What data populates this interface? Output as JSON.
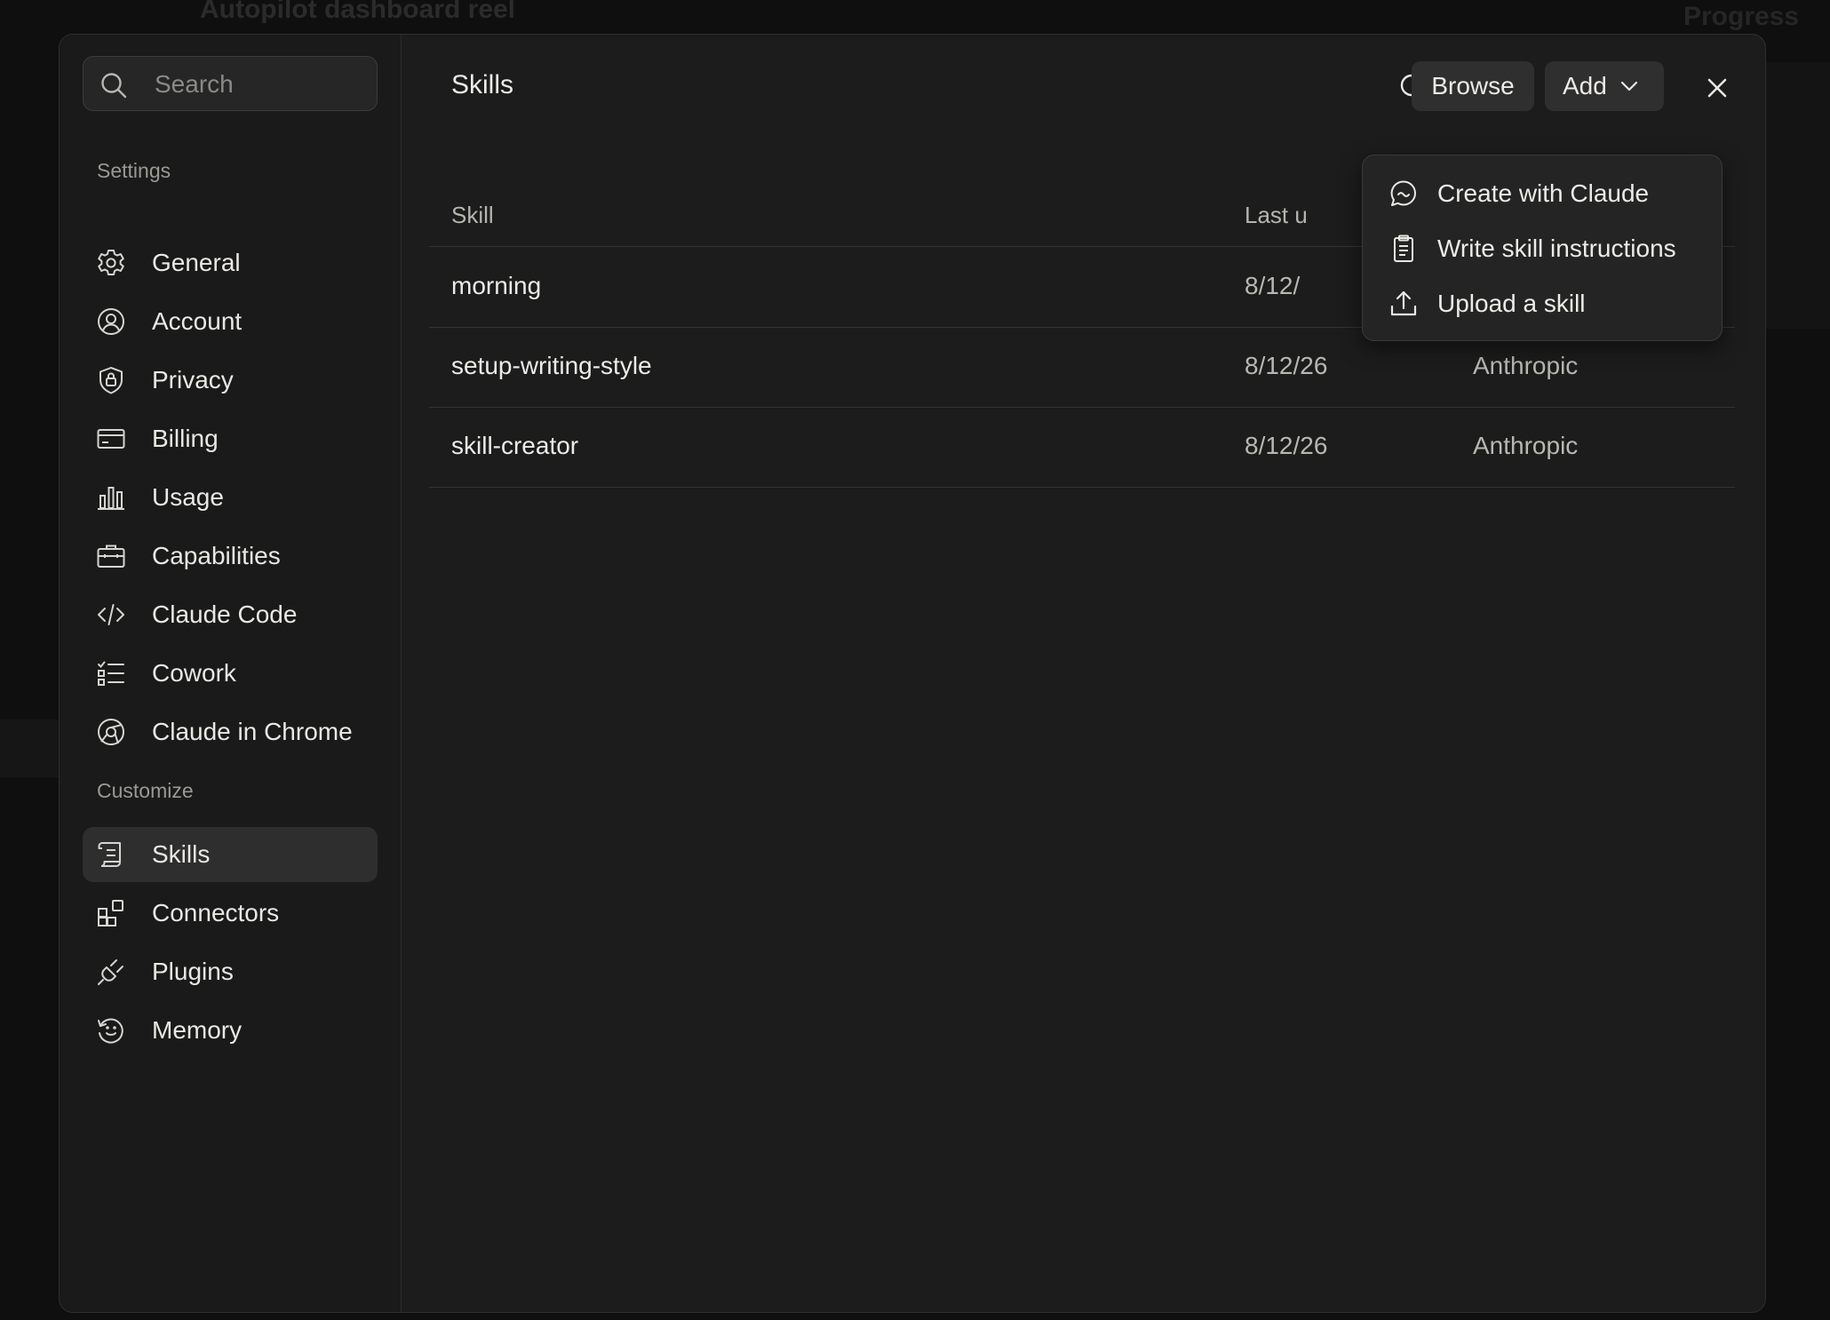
{
  "background": {
    "title": "Autopilot dashboard reel",
    "progress_label": "Progress"
  },
  "sidebar": {
    "search": {
      "placeholder": "Search"
    },
    "settings_label": "Settings",
    "settings_items": [
      {
        "label": "General",
        "icon": "gear-icon"
      },
      {
        "label": "Account",
        "icon": "user-circle-icon"
      },
      {
        "label": "Privacy",
        "icon": "shield-lock-icon"
      },
      {
        "label": "Billing",
        "icon": "credit-card-icon"
      },
      {
        "label": "Usage",
        "icon": "bar-chart-icon"
      },
      {
        "label": "Capabilities",
        "icon": "briefcase-icon"
      },
      {
        "label": "Claude Code",
        "icon": "code-icon"
      },
      {
        "label": "Cowork",
        "icon": "checklist-icon"
      },
      {
        "label": "Claude in Chrome",
        "icon": "globe-icon"
      }
    ],
    "customize_label": "Customize",
    "customize_items": [
      {
        "label": "Skills",
        "icon": "scroll-icon",
        "active": true
      },
      {
        "label": "Connectors",
        "icon": "grid-plus-icon"
      },
      {
        "label": "Plugins",
        "icon": "plug-icon"
      },
      {
        "label": "Memory",
        "icon": "history-icon"
      }
    ]
  },
  "main": {
    "title": "Skills",
    "browse_label": "Browse",
    "add_label": "Add",
    "table": {
      "columns": [
        "Skill",
        "Last u"
      ],
      "rows": [
        {
          "name": "morning",
          "date": "8/12/",
          "source": ""
        },
        {
          "name": "setup-writing-style",
          "date": "8/12/26",
          "source": "Anthropic"
        },
        {
          "name": "skill-creator",
          "date": "8/12/26",
          "source": "Anthropic"
        }
      ]
    },
    "add_menu": [
      {
        "label": "Create with Claude",
        "icon": "chat-bubble-icon"
      },
      {
        "label": "Write skill instructions",
        "icon": "clipboard-icon"
      },
      {
        "label": "Upload a skill",
        "icon": "upload-icon"
      }
    ]
  },
  "colors": {
    "modal_bg": "#1c1c1c",
    "sidebar_bg": "#1a1a1a",
    "active_item_bg": "#2e2e2e",
    "button_bg": "#2f2f2f",
    "text": "#ecebe7",
    "muted_text": "#9a9994"
  }
}
